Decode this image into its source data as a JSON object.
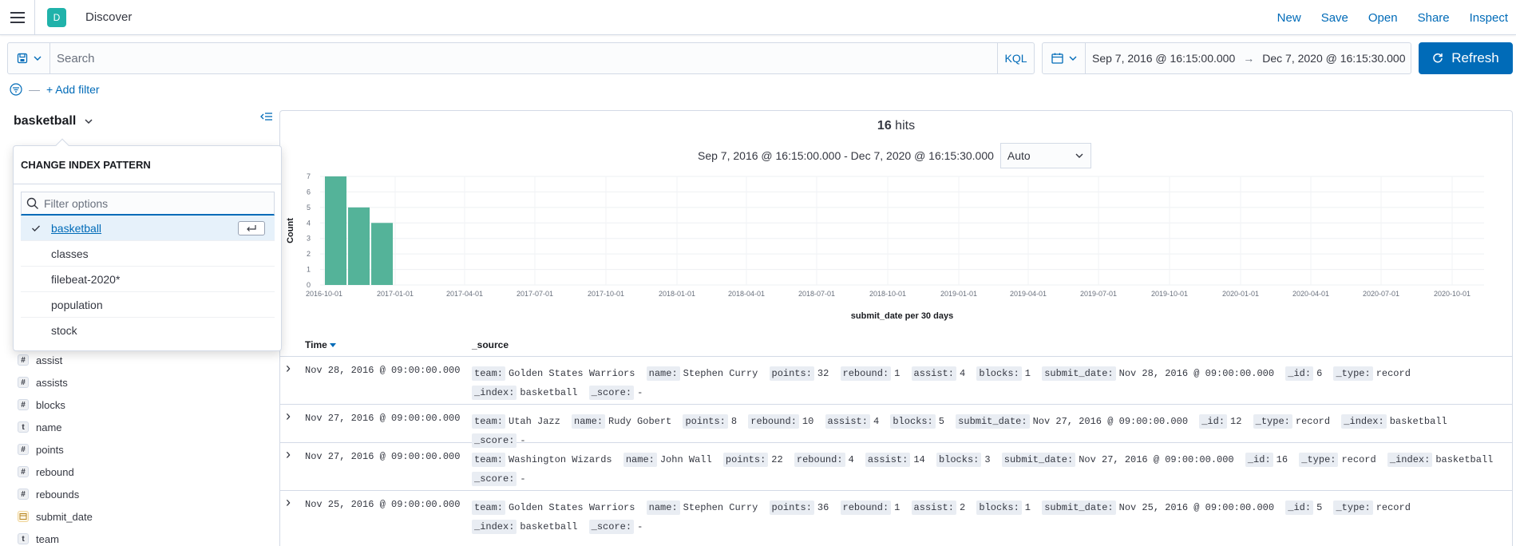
{
  "header": {
    "space_initial": "D",
    "app_title": "Discover",
    "links": {
      "new": "New",
      "save": "Save",
      "open": "Open",
      "share": "Share",
      "inspect": "Inspect"
    }
  },
  "query": {
    "placeholder": "Search",
    "language": "KQL"
  },
  "time": {
    "start": "Sep 7, 2016 @ 16:15:00.000",
    "arrow": "→",
    "end": "Dec 7, 2020 @ 16:15:30.000",
    "refresh_label": "Refresh",
    "range_text": "Sep 7, 2016 @ 16:15:00.000 - Dec 7, 2020 @ 16:15:30.000",
    "interval": "Auto"
  },
  "filters": {
    "add_label": "+ Add filter"
  },
  "sidebar": {
    "index_pattern": "basketball",
    "fields": [
      {
        "type": "#",
        "name": "assist"
      },
      {
        "type": "#",
        "name": "assists"
      },
      {
        "type": "#",
        "name": "blocks"
      },
      {
        "type": "t",
        "name": "name"
      },
      {
        "type": "#",
        "name": "points"
      },
      {
        "type": "#",
        "name": "rebound"
      },
      {
        "type": "#",
        "name": "rebounds"
      },
      {
        "type": "cal",
        "name": "submit_date"
      },
      {
        "type": "t",
        "name": "team"
      }
    ]
  },
  "index_popover": {
    "title": "CHANGE INDEX PATTERN",
    "filter_placeholder": "Filter options",
    "options": [
      "basketball",
      "classes",
      "filebeat-2020*",
      "population",
      "stock"
    ],
    "selected": "basketball"
  },
  "results": {
    "hits_count": "16",
    "hits_label": "hits",
    "columns": {
      "time": "Time",
      "source": "_source"
    },
    "rows": [
      {
        "time": "Nov 28, 2016 @ 09:00:00.000",
        "fields": [
          [
            "team:",
            "Golden States Warriors"
          ],
          [
            "name:",
            "Stephen Curry"
          ],
          [
            "points:",
            "32"
          ],
          [
            "rebound:",
            "1"
          ],
          [
            "assist:",
            "4"
          ],
          [
            "blocks:",
            "1"
          ],
          [
            "submit_date:",
            "Nov 28, 2016 @ 09:00:00.000"
          ],
          [
            "_id:",
            "6"
          ],
          [
            "_type:",
            "record"
          ],
          [
            "_index:",
            "basketball"
          ],
          [
            "_score:",
            "-"
          ]
        ]
      },
      {
        "time": "Nov 27, 2016 @ 09:00:00.000",
        "fields": [
          [
            "team:",
            "Utah Jazz"
          ],
          [
            "name:",
            "Rudy Gobert"
          ],
          [
            "points:",
            "8"
          ],
          [
            "rebound:",
            "10"
          ],
          [
            "assist:",
            "4"
          ],
          [
            "blocks:",
            "5"
          ],
          [
            "submit_date:",
            "Nov 27, 2016 @ 09:00:00.000"
          ],
          [
            "_id:",
            "12"
          ],
          [
            "_type:",
            "record"
          ],
          [
            "_index:",
            "basketball"
          ],
          [
            "_score:",
            "-"
          ]
        ]
      },
      {
        "time": "Nov 27, 2016 @ 09:00:00.000",
        "fields": [
          [
            "team:",
            "Washington Wizards"
          ],
          [
            "name:",
            "John Wall"
          ],
          [
            "points:",
            "22"
          ],
          [
            "rebound:",
            "4"
          ],
          [
            "assist:",
            "14"
          ],
          [
            "blocks:",
            "3"
          ],
          [
            "submit_date:",
            "Nov 27, 2016 @ 09:00:00.000"
          ],
          [
            "_id:",
            "16"
          ],
          [
            "_type:",
            "record"
          ],
          [
            "_index:",
            "basketball"
          ],
          [
            "_score:",
            "-"
          ]
        ]
      },
      {
        "time": "Nov 25, 2016 @ 09:00:00.000",
        "fields": [
          [
            "team:",
            "Golden States Warriors"
          ],
          [
            "name:",
            "Stephen Curry"
          ],
          [
            "points:",
            "36"
          ],
          [
            "rebound:",
            "1"
          ],
          [
            "assist:",
            "2"
          ],
          [
            "blocks:",
            "1"
          ],
          [
            "submit_date:",
            "Nov 25, 2016 @ 09:00:00.000"
          ],
          [
            "_id:",
            "5"
          ],
          [
            "_type:",
            "record"
          ],
          [
            "_index:",
            "basketball"
          ],
          [
            "_score:",
            "-"
          ]
        ]
      }
    ]
  },
  "chart_data": {
    "type": "bar",
    "ylabel": "Count",
    "xlabel": "submit_date per 30 days",
    "ylim": [
      0,
      7
    ],
    "yticks": [
      0,
      1,
      2,
      3,
      4,
      5,
      6,
      7
    ],
    "xticks": [
      "2016-10-01",
      "2017-01-01",
      "2017-04-01",
      "2017-07-01",
      "2017-10-01",
      "2018-01-01",
      "2018-04-01",
      "2018-07-01",
      "2018-10-01",
      "2019-01-01",
      "2019-04-01",
      "2019-07-01",
      "2019-10-01",
      "2020-01-01",
      "2020-04-01",
      "2020-07-01",
      "2020-10-01"
    ],
    "bars": [
      {
        "start": "2016-10-01",
        "value": 7
      },
      {
        "start": "2016-10-31",
        "value": 5
      },
      {
        "start": "2016-11-30",
        "value": 4
      }
    ],
    "bar_color": "#54b399",
    "grid": true
  },
  "colors": {
    "accent": "#006bb8",
    "border": "#d3dae6",
    "bar": "#54b399"
  }
}
